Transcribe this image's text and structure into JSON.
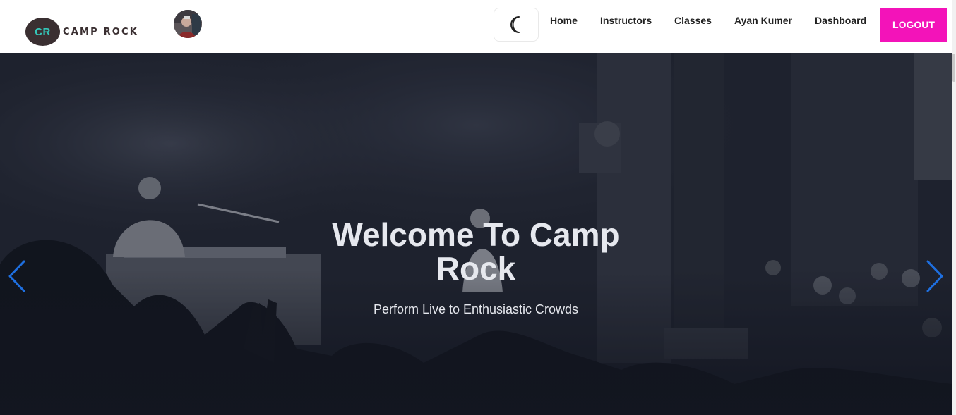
{
  "brand": {
    "badge_text": "CR",
    "name": "CAMP ROCK"
  },
  "header": {
    "avatar_alt": "User avatar",
    "theme_toggle_icon": "moon-icon",
    "nav": {
      "home": "Home",
      "instructors": "Instructors",
      "classes": "Classes",
      "user": "Ayan Kumer",
      "dashboard": "Dashboard"
    },
    "logout_label": "LOGOUT"
  },
  "hero": {
    "title": "Welcome To Camp Rock",
    "subtitle": "Perform Live to Enthusiastic Crowds",
    "prev_icon": "chevron-left-icon",
    "next_icon": "chevron-right-icon"
  },
  "colors": {
    "accent": "#f313b9",
    "brand_dark": "#3a2f31",
    "brand_teal": "#34c7b9",
    "carousel_arrow": "#1e6fe0",
    "hero_text": "#e6e8ee"
  }
}
